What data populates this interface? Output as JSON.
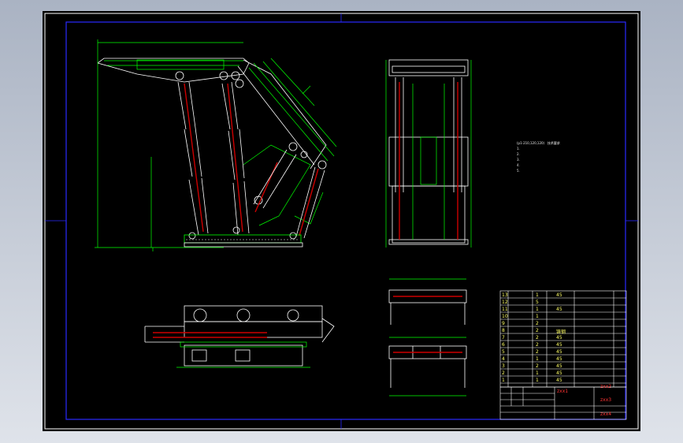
{
  "title_block": {
    "code1": "zxx1",
    "code2": "zxx2",
    "code3": "zxx3",
    "code4": "zxx4"
  },
  "tech_notes": {
    "heading_prefix": "(p1-210,120,120)",
    "heading": "技术要求",
    "items": [
      "1.",
      "2.",
      "3.",
      "4.",
      "5."
    ]
  },
  "bom": {
    "row_numbers": [
      "13",
      "12",
      "11",
      "10",
      "9",
      "8",
      "7",
      "6",
      "5",
      "4",
      "3",
      "2",
      "1"
    ],
    "qty": [
      "1",
      "5",
      "1",
      "1",
      "2",
      "2",
      "2",
      "2",
      "2",
      "1",
      "2",
      "1",
      "1"
    ],
    "material": [
      "45",
      "",
      "45",
      "",
      "",
      "铸钢",
      "45",
      "45",
      "45",
      "45",
      "45",
      "45",
      "45"
    ],
    "header": [
      "序号",
      "名称",
      "数量",
      "材料",
      "备注"
    ]
  },
  "colors": {
    "sheet": "#000000",
    "outline": "#ffffff",
    "frame": "#0000ff",
    "part": "#00ff00",
    "cylinder": "#cc0000",
    "text_main": "#ffff00",
    "title_text": "#ff00ff"
  }
}
